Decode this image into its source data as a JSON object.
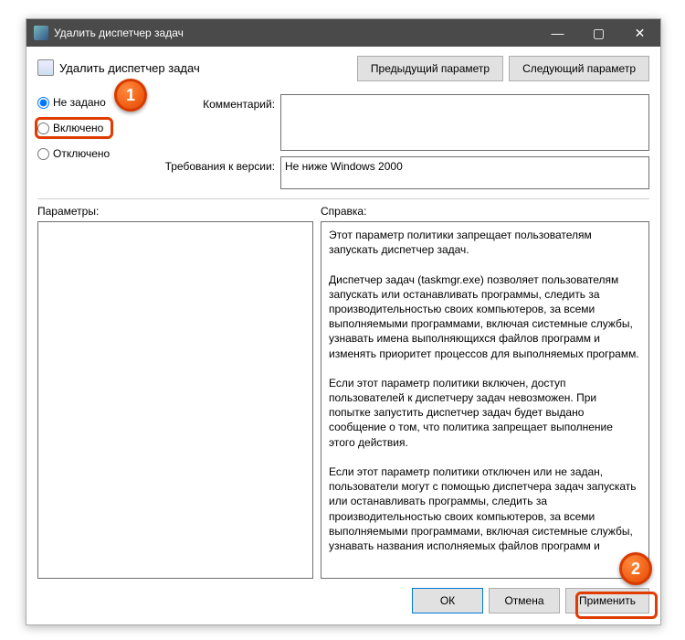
{
  "window": {
    "title": "Удалить диспетчер задач"
  },
  "header": {
    "policy_name": "Удалить диспетчер задач",
    "prev_button": "Предыдущий параметр",
    "next_button": "Следующий параметр"
  },
  "radios": {
    "not_configured": "Не задано",
    "enabled": "Включено",
    "disabled": "Отключено",
    "selected": "not_configured"
  },
  "fields": {
    "comment_label": "Комментарий:",
    "comment_value": "",
    "version_label": "Требования к версии:",
    "version_value": "Не ниже Windows 2000"
  },
  "lower": {
    "params_label": "Параметры:",
    "help_label": "Справка:",
    "help_text": "Этот параметр политики запрещает пользователям запускать диспетчер задач.\n\nДиспетчер задач (taskmgr.exe) позволяет пользователям запускать или останавливать программы, следить за производительностью своих компьютеров, за всеми выполняемыми программами, включая системные службы, узнавать имена выполняющихся файлов программ и изменять приоритет процессов для выполняемых программ.\n\nЕсли этот параметр политики включен, доступ пользователей к диспетчеру задач невозможен. При попытке запустить диспетчер задач будет выдано сообщение о том, что политика запрещает выполнение этого действия.\n\nЕсли этот параметр политики отключен или не задан, пользователи могут с помощью диспетчера задач запускать или останавливать программы, следить за производительностью своих компьютеров, за всеми выполняемыми программами, включая системные службы, узнавать названия исполняемых файлов программ и"
  },
  "footer": {
    "ok": "ОК",
    "cancel": "Отмена",
    "apply": "Применить"
  },
  "callouts": {
    "one": "1",
    "two": "2"
  }
}
